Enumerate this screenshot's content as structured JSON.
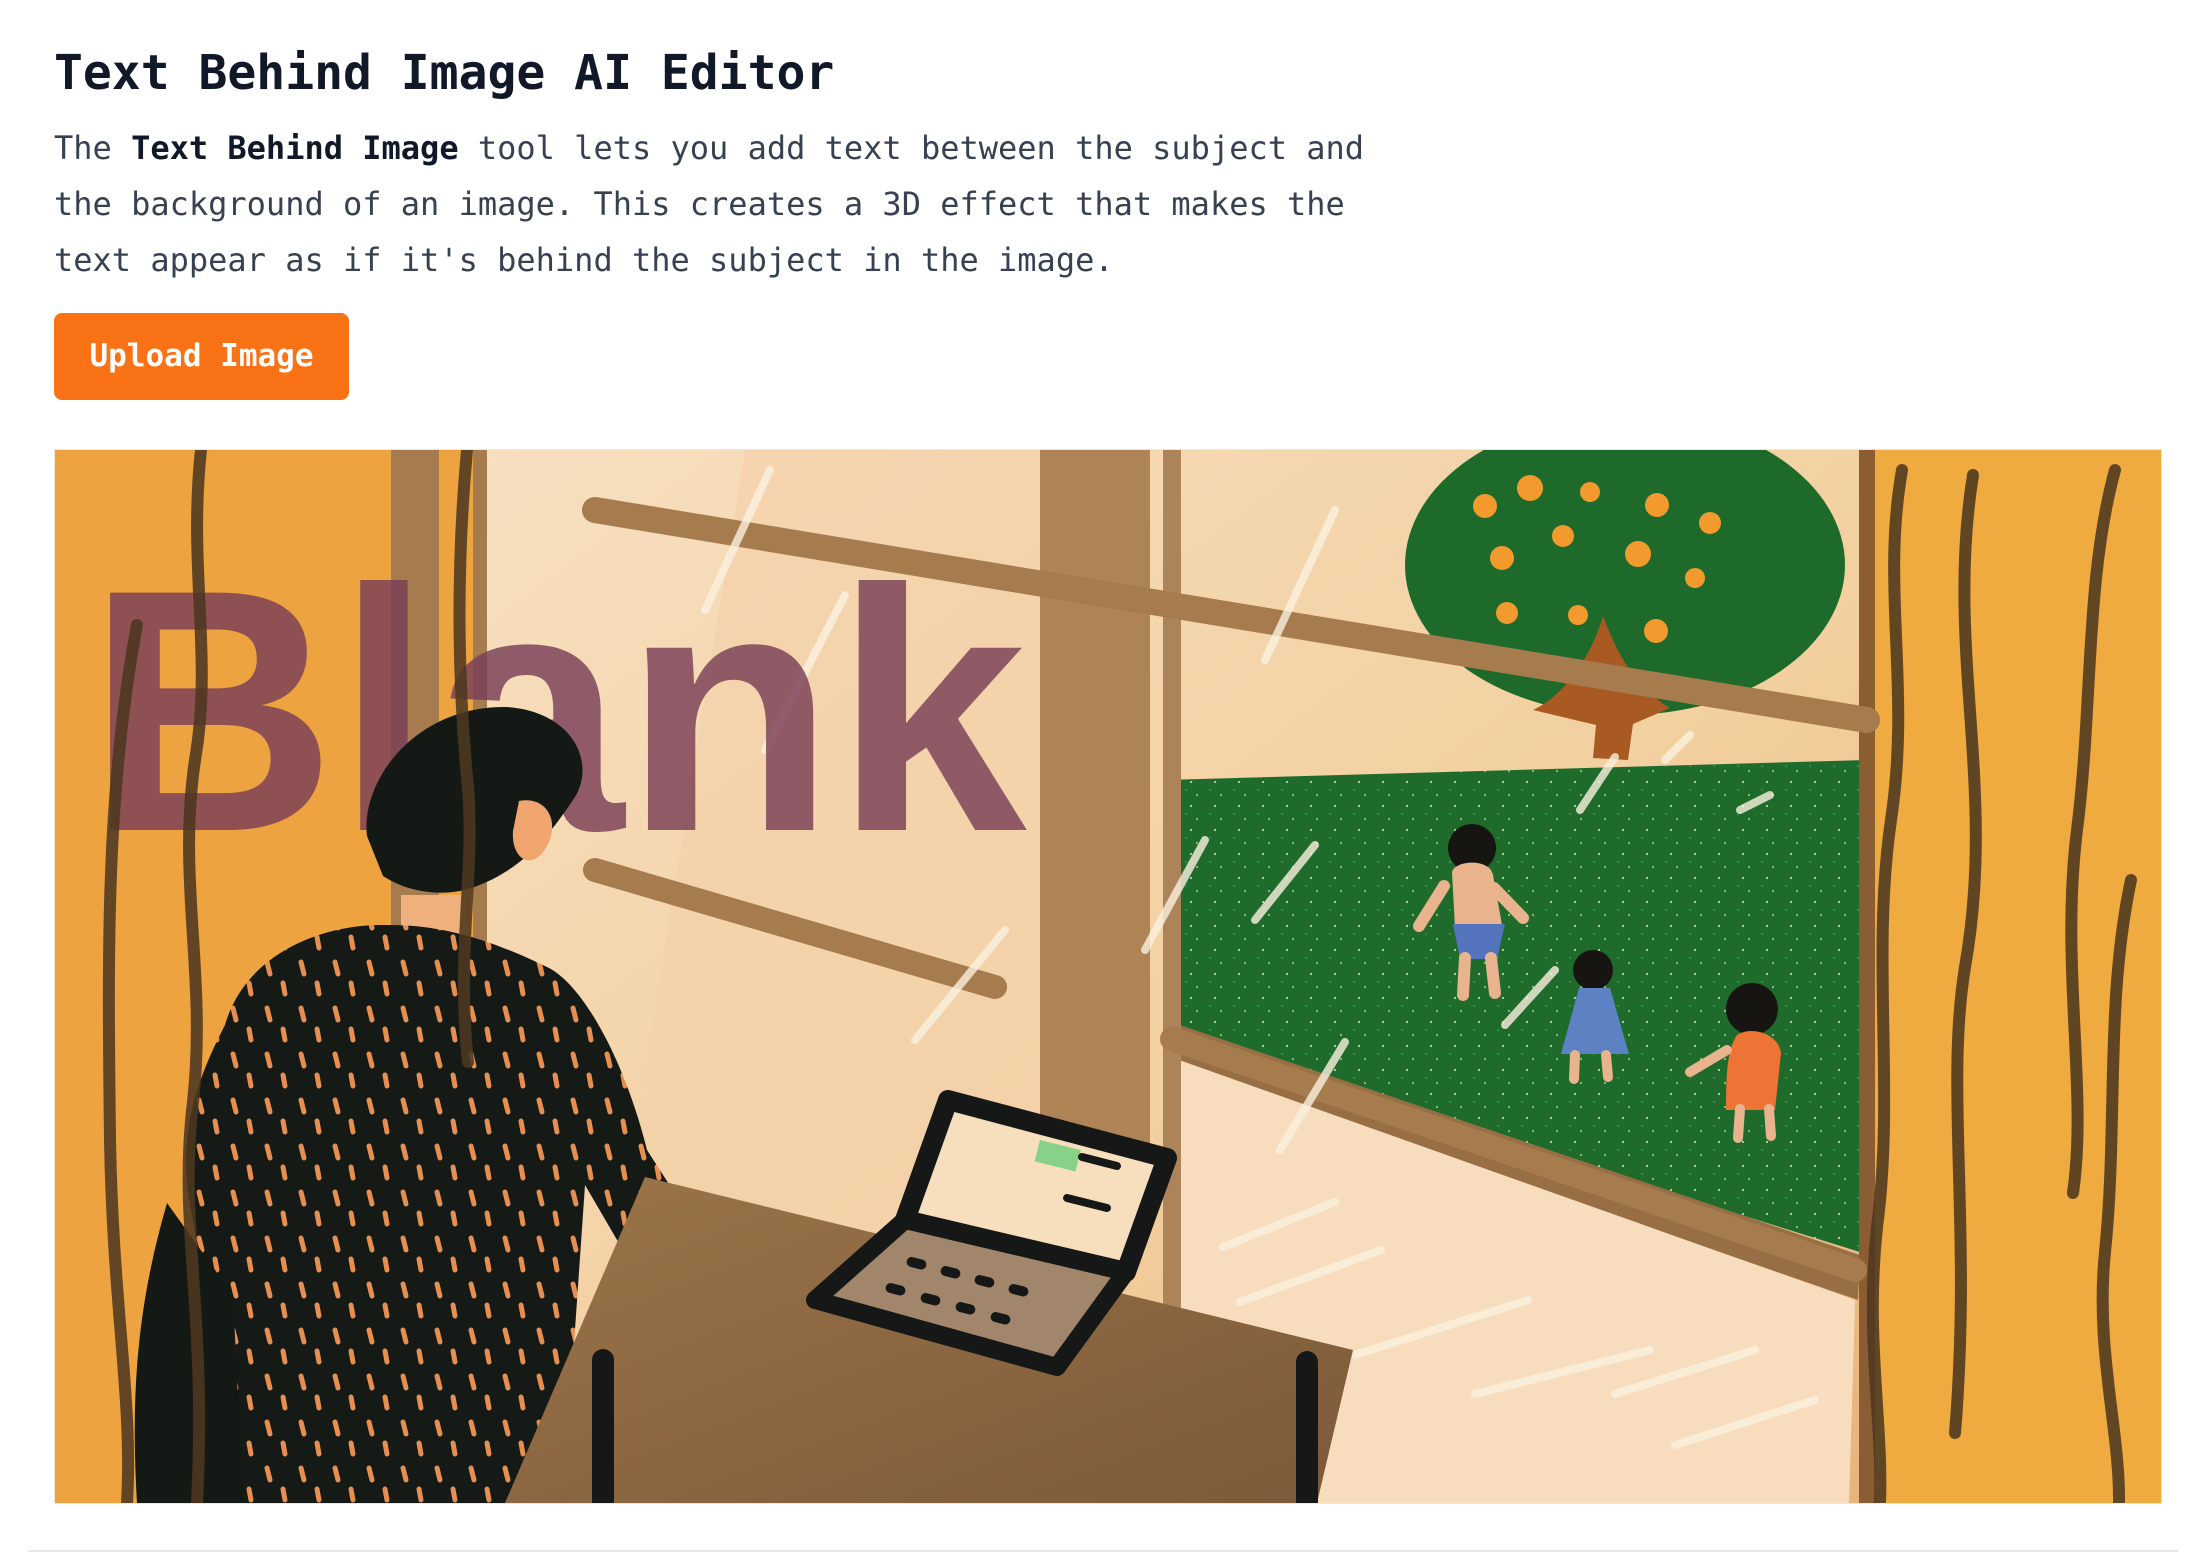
{
  "header": {
    "title": "Text Behind Image AI Editor",
    "description": {
      "prefix": "The ",
      "highlight": "Text Behind Image",
      "suffix": " tool lets you add text between the subject and the background of an image. This creates a 3D effect that makes the text appear as if it's behind the subject in the image."
    }
  },
  "actions": {
    "upload_label": "Upload Image"
  },
  "editor": {
    "overlay_text": "Blank",
    "colors": {
      "accent": "#f97316",
      "overlay_text": "#7a3f57",
      "curtain": "#f0aa43",
      "grass": "#1f6b2c",
      "tree_fruit": "#f39a2f",
      "shirt": "#151a16"
    }
  }
}
